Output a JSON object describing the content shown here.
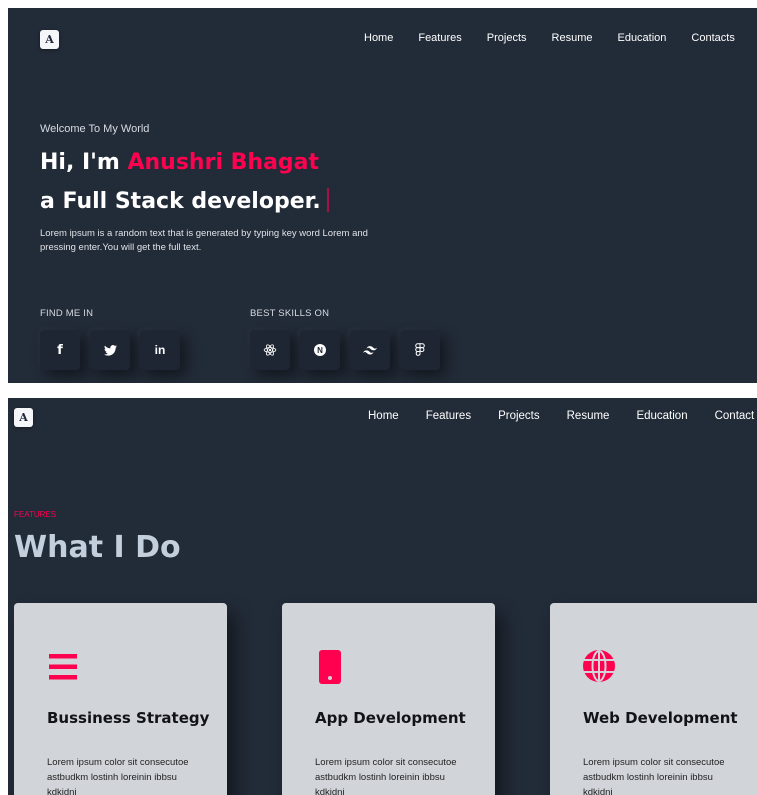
{
  "logo": {
    "letter": "A"
  },
  "nav": {
    "items": [
      {
        "label": "Home"
      },
      {
        "label": "Features"
      },
      {
        "label": "Projects"
      },
      {
        "label": "Resume"
      },
      {
        "label": "Education"
      },
      {
        "label": "Contacts"
      }
    ],
    "clipped_last_label": "Contact"
  },
  "hero": {
    "welcome": "Welcome To My World",
    "greeting": "Hi, I'm ",
    "name": "Anushri Bhagat",
    "role": "a Full Stack developer.",
    "description": "Lorem ipsum is a random text that is generated by typing key word Lorem and pressing enter.You will get the full text.",
    "find_me_label": "FIND ME IN",
    "skills_label": "BEST SKILLS ON",
    "social": [
      {
        "icon": "facebook-icon",
        "glyph": "f"
      },
      {
        "icon": "twitter-icon",
        "glyph": "twitter"
      },
      {
        "icon": "linkedin-icon",
        "glyph": "in"
      }
    ],
    "skills": [
      {
        "icon": "react-icon"
      },
      {
        "icon": "nextjs-icon",
        "glyph": "N"
      },
      {
        "icon": "tailwind-icon"
      },
      {
        "icon": "figma-icon"
      }
    ]
  },
  "features": {
    "eyebrow": "FEATURES",
    "title": "What I Do",
    "cards": [
      {
        "icon": "menu-icon",
        "title": "Bussiness Strategy",
        "text": "Lorem ipsum color sit consecutoe astbudkm lostinh loreinin ibbsu kdkidni"
      },
      {
        "icon": "smartphone-icon",
        "title": "App Development",
        "text": "Lorem ipsum color sit consecutoe astbudkm lostinh loreinin ibbsu kdkidni"
      },
      {
        "icon": "globe-icon",
        "title": "Web Development",
        "text": "Lorem ipsum color sit consecutoe astbudkm lostinh loreinin ibbsu kdkidni"
      }
    ]
  },
  "colors": {
    "accent": "#ff014f",
    "background": "#222b38",
    "card": "#d1d5da",
    "title_muted": "#c4cfde"
  }
}
